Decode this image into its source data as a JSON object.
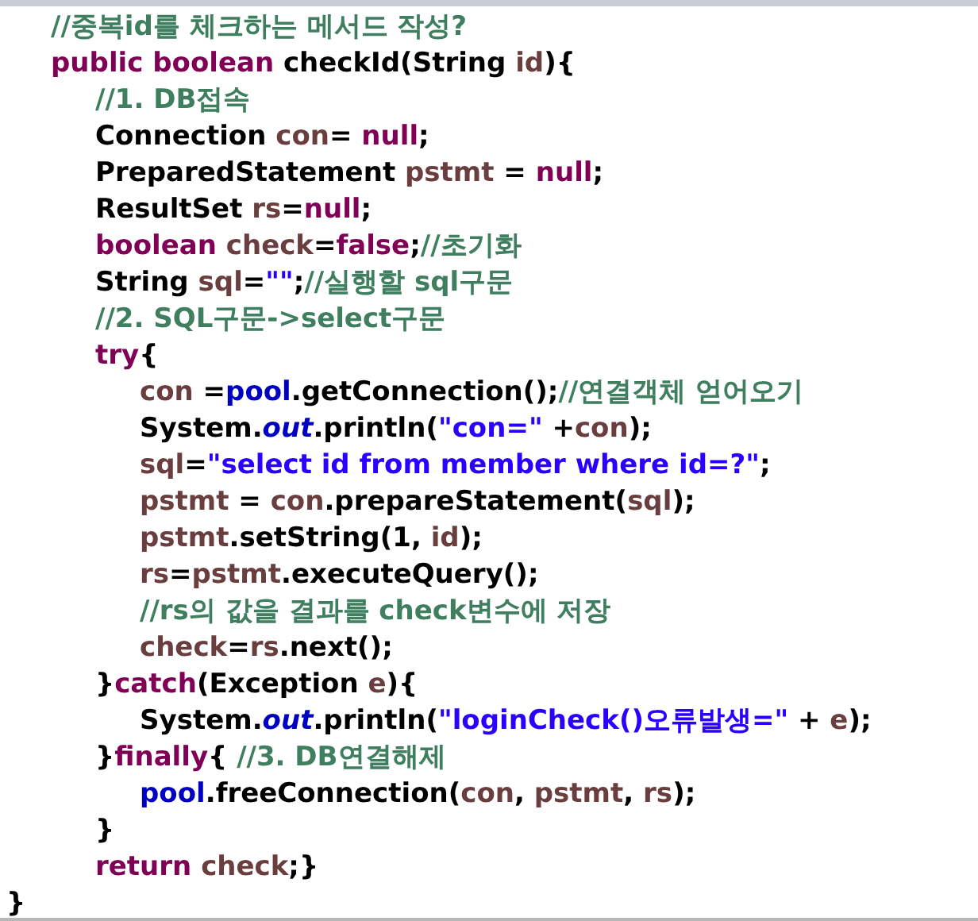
{
  "editor": {
    "lines": [
      {
        "children": [
          {
            "tokens": [
              {
                "kind": "comment",
                "text": "//중복id를 체크하는 메서드 작성?"
              }
            ]
          },
          {
            "tokens": [
              {
                "kind": "keyword",
                "text": "public boolean "
              },
              {
                "kind": "plain",
                "text": "checkId(String "
              },
              {
                "kind": "variable",
                "text": "id"
              },
              {
                "kind": "plain",
                "text": "){"
              }
            ],
            "children": [
              {
                "tokens": [
                  {
                    "kind": "comment",
                    "text": "//1. DB접속"
                  }
                ]
              },
              {
                "tokens": [
                  {
                    "kind": "plain",
                    "text": "Connection "
                  },
                  {
                    "kind": "variable",
                    "text": "con"
                  },
                  {
                    "kind": "plain",
                    "text": "= "
                  },
                  {
                    "kind": "keyword",
                    "text": "null"
                  },
                  {
                    "kind": "plain",
                    "text": ";"
                  }
                ]
              },
              {
                "tokens": [
                  {
                    "kind": "plain",
                    "text": "PreparedStatement "
                  },
                  {
                    "kind": "variable",
                    "text": "pstmt"
                  },
                  {
                    "kind": "plain",
                    "text": " = "
                  },
                  {
                    "kind": "keyword",
                    "text": "null"
                  },
                  {
                    "kind": "plain",
                    "text": ";"
                  }
                ]
              },
              {
                "tokens": [
                  {
                    "kind": "plain",
                    "text": "ResultSet "
                  },
                  {
                    "kind": "variable",
                    "text": "rs"
                  },
                  {
                    "kind": "plain",
                    "text": "="
                  },
                  {
                    "kind": "keyword",
                    "text": "null"
                  },
                  {
                    "kind": "plain",
                    "text": ";"
                  }
                ]
              },
              {
                "tokens": [
                  {
                    "kind": "keyword",
                    "text": "boolean "
                  },
                  {
                    "kind": "variable",
                    "text": "check"
                  },
                  {
                    "kind": "plain",
                    "text": "="
                  },
                  {
                    "kind": "keyword",
                    "text": "false"
                  },
                  {
                    "kind": "plain",
                    "text": ";"
                  },
                  {
                    "kind": "comment",
                    "text": "//초기화"
                  }
                ]
              },
              {
                "tokens": [
                  {
                    "kind": "plain",
                    "text": "String "
                  },
                  {
                    "kind": "variable",
                    "text": "sql"
                  },
                  {
                    "kind": "plain",
                    "text": "="
                  },
                  {
                    "kind": "string",
                    "text": "\"\""
                  },
                  {
                    "kind": "plain",
                    "text": ";"
                  },
                  {
                    "kind": "comment",
                    "text": "//실행할 sql구문"
                  }
                ]
              },
              {
                "tokens": [
                  {
                    "kind": "comment",
                    "text": "//2. SQL구문->select구문"
                  }
                ]
              },
              {
                "tokens": [
                  {
                    "kind": "keyword",
                    "text": "try"
                  },
                  {
                    "kind": "plain",
                    "text": "{"
                  }
                ],
                "children": [
                  {
                    "tokens": [
                      {
                        "kind": "variable",
                        "text": "con"
                      },
                      {
                        "kind": "plain",
                        "text": " ="
                      },
                      {
                        "kind": "field",
                        "text": "pool"
                      },
                      {
                        "kind": "plain",
                        "text": ".getConnection();"
                      },
                      {
                        "kind": "comment",
                        "text": "//연결객체 얻어오기"
                      }
                    ]
                  },
                  {
                    "tokens": [
                      {
                        "kind": "plain",
                        "text": "System."
                      },
                      {
                        "kind": "static",
                        "text": "out"
                      },
                      {
                        "kind": "plain",
                        "text": ".println("
                      },
                      {
                        "kind": "string",
                        "text": "\"con=\""
                      },
                      {
                        "kind": "plain",
                        "text": " +"
                      },
                      {
                        "kind": "variable",
                        "text": "con"
                      },
                      {
                        "kind": "plain",
                        "text": ");"
                      }
                    ]
                  },
                  {
                    "tokens": [
                      {
                        "kind": "variable",
                        "text": "sql"
                      },
                      {
                        "kind": "plain",
                        "text": "="
                      },
                      {
                        "kind": "string",
                        "text": "\"select id from member where id=?\""
                      },
                      {
                        "kind": "plain",
                        "text": ";"
                      }
                    ]
                  },
                  {
                    "tokens": [
                      {
                        "kind": "variable",
                        "text": "pstmt"
                      },
                      {
                        "kind": "plain",
                        "text": " = "
                      },
                      {
                        "kind": "variable",
                        "text": "con"
                      },
                      {
                        "kind": "plain",
                        "text": ".prepareStatement("
                      },
                      {
                        "kind": "variable",
                        "text": "sql"
                      },
                      {
                        "kind": "plain",
                        "text": ");"
                      }
                    ]
                  },
                  {
                    "tokens": [
                      {
                        "kind": "variable",
                        "text": "pstmt"
                      },
                      {
                        "kind": "plain",
                        "text": ".setString(1, "
                      },
                      {
                        "kind": "variable",
                        "text": "id"
                      },
                      {
                        "kind": "plain",
                        "text": ");"
                      }
                    ]
                  },
                  {
                    "tokens": [
                      {
                        "kind": "variable",
                        "text": "rs"
                      },
                      {
                        "kind": "plain",
                        "text": "="
                      },
                      {
                        "kind": "variable",
                        "text": "pstmt"
                      },
                      {
                        "kind": "plain",
                        "text": ".executeQuery();"
                      }
                    ]
                  },
                  {
                    "tokens": [
                      {
                        "kind": "comment",
                        "text": "//rs의 값을 결과를 check변수에 저장"
                      }
                    ]
                  },
                  {
                    "tokens": [
                      {
                        "kind": "variable",
                        "text": "check"
                      },
                      {
                        "kind": "plain",
                        "text": "="
                      },
                      {
                        "kind": "variable",
                        "text": "rs"
                      },
                      {
                        "kind": "plain",
                        "text": ".next();"
                      }
                    ]
                  }
                ]
              },
              {
                "tokens": [
                  {
                    "kind": "plain",
                    "text": "}"
                  },
                  {
                    "kind": "keyword",
                    "text": "catch"
                  },
                  {
                    "kind": "plain",
                    "text": "(Exception "
                  },
                  {
                    "kind": "variable",
                    "text": "e"
                  },
                  {
                    "kind": "plain",
                    "text": "){"
                  }
                ],
                "children": [
                  {
                    "tokens": [
                      {
                        "kind": "plain",
                        "text": "System."
                      },
                      {
                        "kind": "static",
                        "text": "out"
                      },
                      {
                        "kind": "plain",
                        "text": ".println("
                      },
                      {
                        "kind": "string",
                        "text": "\"loginCheck()오류발생=\""
                      },
                      {
                        "kind": "plain",
                        "text": " + "
                      },
                      {
                        "kind": "variable",
                        "text": "e"
                      },
                      {
                        "kind": "plain",
                        "text": ");"
                      }
                    ]
                  }
                ]
              },
              {
                "tokens": [
                  {
                    "kind": "plain",
                    "text": "}"
                  },
                  {
                    "kind": "keyword",
                    "text": "finally"
                  },
                  {
                    "kind": "plain",
                    "text": "{ "
                  },
                  {
                    "kind": "comment",
                    "text": "//3. DB연결해제"
                  }
                ],
                "children": [
                  {
                    "tokens": [
                      {
                        "kind": "field",
                        "text": "pool"
                      },
                      {
                        "kind": "plain",
                        "text": ".freeConnection("
                      },
                      {
                        "kind": "variable",
                        "text": "con"
                      },
                      {
                        "kind": "plain",
                        "text": ", "
                      },
                      {
                        "kind": "variable",
                        "text": "pstmt"
                      },
                      {
                        "kind": "plain",
                        "text": ", "
                      },
                      {
                        "kind": "variable",
                        "text": "rs"
                      },
                      {
                        "kind": "plain",
                        "text": ");"
                      }
                    ]
                  }
                ]
              },
              {
                "tokens": [
                  {
                    "kind": "plain",
                    "text": "}"
                  }
                ]
              },
              {
                "tokens": [
                  {
                    "kind": "keyword",
                    "text": "return "
                  },
                  {
                    "kind": "variable",
                    "text": "check"
                  },
                  {
                    "kind": "plain",
                    "text": ";}"
                  }
                ]
              }
            ]
          }
        ]
      },
      {
        "tokens": [
          {
            "kind": "plain",
            "text": "}"
          }
        ]
      }
    ]
  }
}
